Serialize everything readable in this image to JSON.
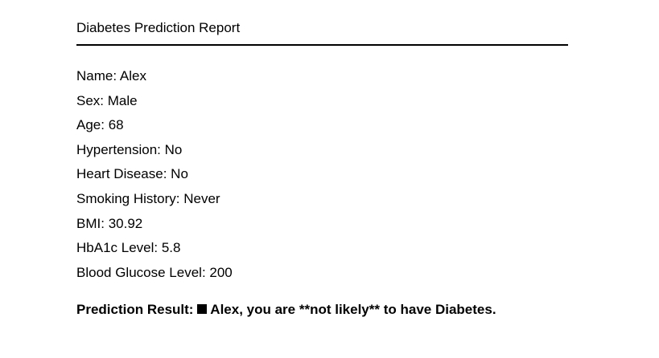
{
  "report": {
    "title": "Diabetes Prediction Report",
    "fields": [
      {
        "label": "Name",
        "value": "Alex"
      },
      {
        "label": "Sex",
        "value": "Male"
      },
      {
        "label": "Age",
        "value": "68"
      },
      {
        "label": "Hypertension",
        "value": "No"
      },
      {
        "label": "Heart Disease",
        "value": "No"
      },
      {
        "label": "Smoking History",
        "value": "Never"
      },
      {
        "label": "BMI",
        "value": "30.92"
      },
      {
        "label": "HbA1c Level",
        "value": "5.8"
      },
      {
        "label": "Blood Glucose Level",
        "value": "200"
      }
    ],
    "result": {
      "label": "Prediction Result:",
      "icon": "black-square-icon",
      "message": "Alex, you are **not likely** to have Diabetes."
    }
  }
}
